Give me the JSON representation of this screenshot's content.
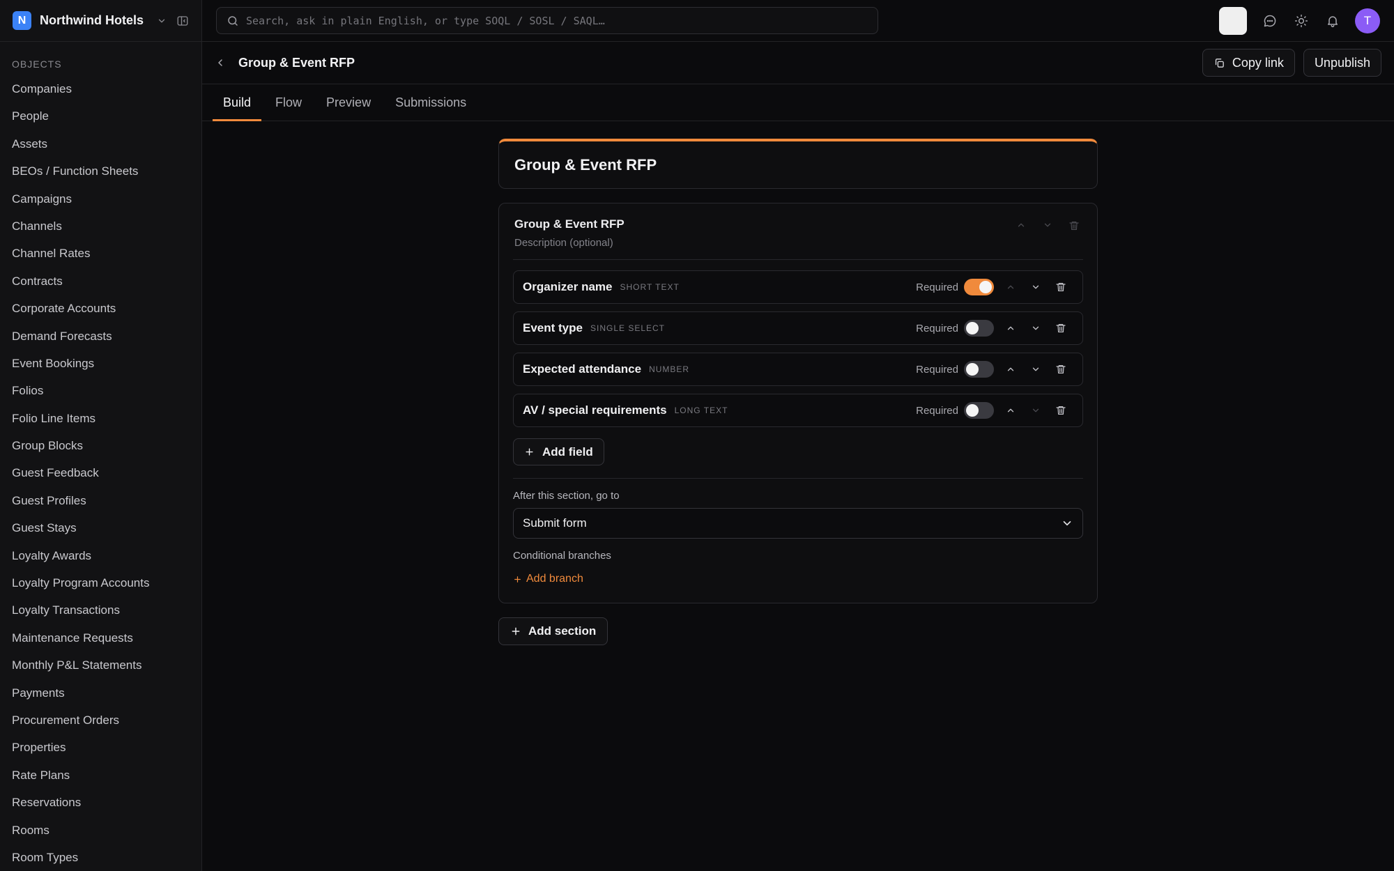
{
  "workspace": {
    "initial": "N",
    "name": "Northwind Hotels"
  },
  "sidebar": {
    "heading": "OBJECTS",
    "items": [
      {
        "label": "Companies"
      },
      {
        "label": "People"
      },
      {
        "label": "Assets"
      },
      {
        "label": "BEOs / Function Sheets"
      },
      {
        "label": "Campaigns"
      },
      {
        "label": "Channels"
      },
      {
        "label": "Channel Rates"
      },
      {
        "label": "Contracts"
      },
      {
        "label": "Corporate Accounts"
      },
      {
        "label": "Demand Forecasts"
      },
      {
        "label": "Event Bookings"
      },
      {
        "label": "Folios"
      },
      {
        "label": "Folio Line Items"
      },
      {
        "label": "Group Blocks"
      },
      {
        "label": "Guest Feedback"
      },
      {
        "label": "Guest Profiles"
      },
      {
        "label": "Guest Stays"
      },
      {
        "label": "Loyalty Awards"
      },
      {
        "label": "Loyalty Program Accounts"
      },
      {
        "label": "Loyalty Transactions"
      },
      {
        "label": "Maintenance Requests"
      },
      {
        "label": "Monthly P&L Statements"
      },
      {
        "label": "Payments"
      },
      {
        "label": "Procurement Orders"
      },
      {
        "label": "Properties"
      },
      {
        "label": "Rate Plans"
      },
      {
        "label": "Reservations"
      },
      {
        "label": "Rooms"
      },
      {
        "label": "Room Types"
      }
    ]
  },
  "search": {
    "placeholder": "Search, ask in plain English, or type SOQL / SOSL / SAQL…",
    "value": ""
  },
  "user": {
    "initial": "T",
    "avatar_color": "#8b5cf6"
  },
  "page": {
    "title": "Group & Event RFP",
    "copy_link_label": "Copy link",
    "unpublish_label": "Unpublish"
  },
  "tabs": [
    {
      "label": "Build",
      "active": true
    },
    {
      "label": "Flow",
      "active": false
    },
    {
      "label": "Preview",
      "active": false
    },
    {
      "label": "Submissions",
      "active": false
    }
  ],
  "form": {
    "title": "Group & Event RFP",
    "section": {
      "title": "Group & Event RFP",
      "description_placeholder": "Description (optional)",
      "required_label": "Required",
      "fields": [
        {
          "label": "Organizer name",
          "type": "SHORT TEXT",
          "required": true
        },
        {
          "label": "Event type",
          "type": "SINGLE SELECT",
          "required": false
        },
        {
          "label": "Expected attendance",
          "type": "NUMBER",
          "required": false
        },
        {
          "label": "AV / special requirements",
          "type": "LONG TEXT",
          "required": false
        }
      ],
      "add_field_label": "Add field",
      "after_section_label": "After this section, go to",
      "after_section_value": "Submit form",
      "conditional_branches_label": "Conditional branches",
      "add_branch_label": "Add branch"
    },
    "add_section_label": "Add section"
  },
  "colors": {
    "accent": "#f08a3c",
    "workspace_logo": "#3b82f6",
    "background": "#0b0b0d"
  }
}
